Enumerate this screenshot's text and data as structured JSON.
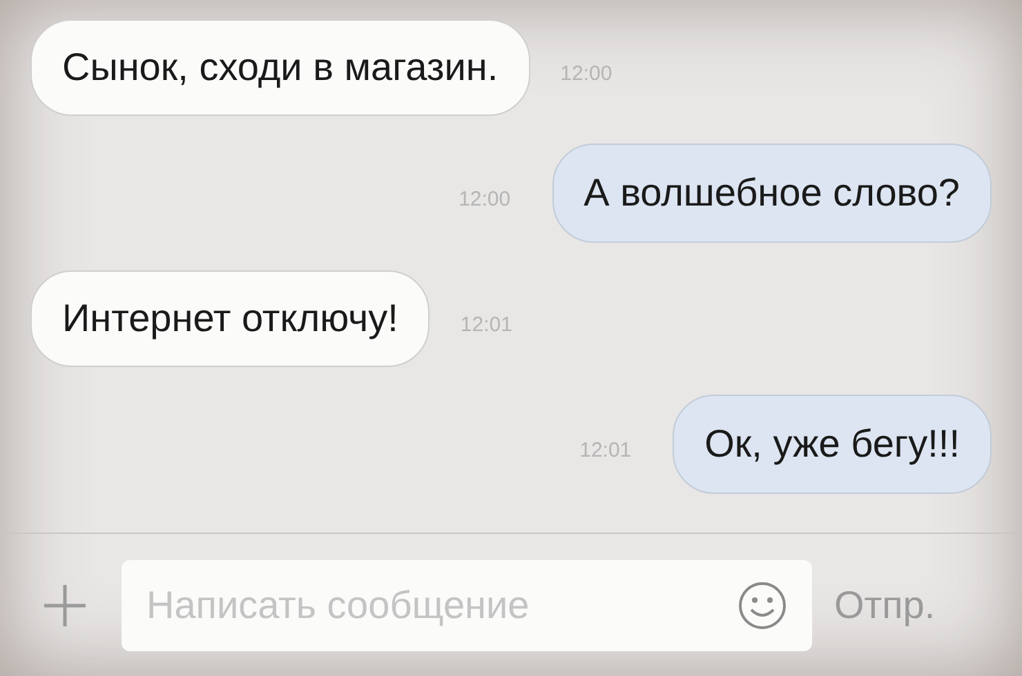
{
  "messages": [
    {
      "kind": "incoming",
      "text": "Сынок, сходи в магазин.",
      "time": "12:00"
    },
    {
      "kind": "outgoing",
      "text": "А волшебное слово?",
      "time": "12:00"
    },
    {
      "kind": "incoming",
      "text": "Интернет отключу!",
      "time": "12:01"
    },
    {
      "kind": "outgoing",
      "text": "Ок, уже бегу!!!",
      "time": "12:01"
    }
  ],
  "composer": {
    "placeholder": "Написать сообщение",
    "send_label": "Отпр."
  }
}
